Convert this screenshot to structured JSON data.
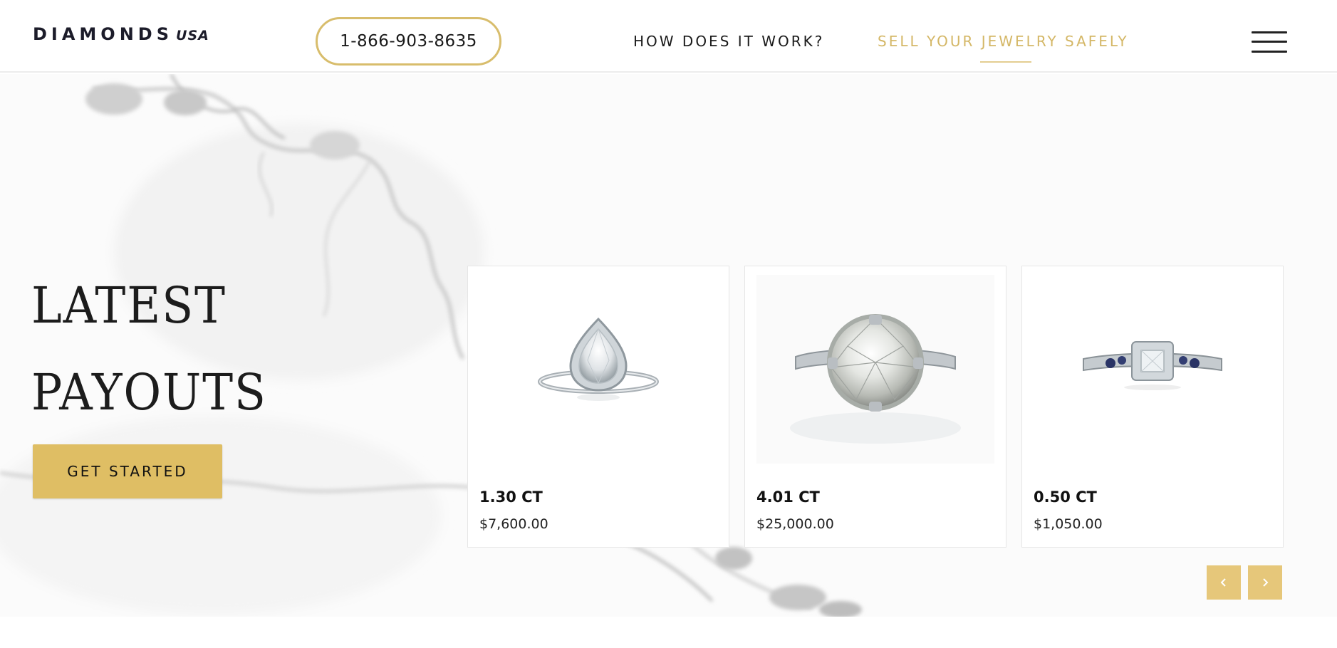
{
  "header": {
    "logo_main": "DIAMONDS",
    "logo_sub": "USA",
    "phone": "1-866-903-8635",
    "nav": [
      {
        "label": "HOW DOES IT WORK?",
        "active": false
      },
      {
        "label": "SELL YOUR JEWELRY SAFELY",
        "active": true
      }
    ],
    "menu_icon": "hamburger-menu-icon"
  },
  "hero": {
    "title_line1": "LATEST",
    "title_line2": "PAYOUTS",
    "cta_label": "GET STARTED"
  },
  "payouts": [
    {
      "carat": "1.30 CT",
      "price": "$7,600.00",
      "image": "pear-halo-diamond-ring"
    },
    {
      "carat": "4.01 CT",
      "price": "$25,000.00",
      "image": "round-solitaire-diamond-ring"
    },
    {
      "carat": "0.50 CT",
      "price": "$1,050.00",
      "image": "princess-halo-sapphire-ring"
    }
  ],
  "carousel": {
    "prev_icon": "chevron-left-icon",
    "next_icon": "chevron-right-icon"
  },
  "colors": {
    "gold": "#dfbe64",
    "gold_light": "#e6c77a",
    "nav_active": "#d4b766",
    "text": "#1a1a1a"
  }
}
